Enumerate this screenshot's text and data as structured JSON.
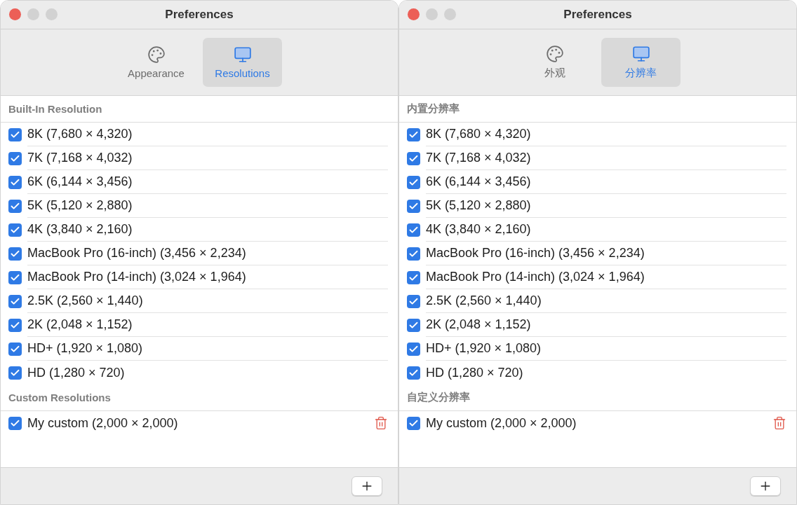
{
  "windows": [
    {
      "title": "Preferences",
      "tabs": [
        {
          "kind": "palette",
          "label": "Appearance",
          "selected": false
        },
        {
          "kind": "display",
          "label": "Resolutions",
          "selected": true
        }
      ],
      "sections": [
        {
          "title": "Built-In Resolution",
          "items": [
            {
              "label": "8K (7,680 × 4,320)",
              "checked": true,
              "removable": false
            },
            {
              "label": "7K (7,168 × 4,032)",
              "checked": true,
              "removable": false
            },
            {
              "label": "6K (6,144 × 3,456)",
              "checked": true,
              "removable": false
            },
            {
              "label": "5K (5,120 × 2,880)",
              "checked": true,
              "removable": false
            },
            {
              "label": "4K (3,840 × 2,160)",
              "checked": true,
              "removable": false
            },
            {
              "label": "MacBook Pro (16-inch) (3,456 × 2,234)",
              "checked": true,
              "removable": false
            },
            {
              "label": "MacBook Pro (14-inch) (3,024 × 1,964)",
              "checked": true,
              "removable": false
            },
            {
              "label": "2.5K (2,560 × 1,440)",
              "checked": true,
              "removable": false
            },
            {
              "label": "2K (2,048 × 1,152)",
              "checked": true,
              "removable": false
            },
            {
              "label": "HD+ (1,920 × 1,080)",
              "checked": true,
              "removable": false
            },
            {
              "label": "HD (1,280 × 720)",
              "checked": true,
              "removable": false
            }
          ]
        },
        {
          "title": "Custom Resolutions",
          "items": [
            {
              "label": "My custom (2,000 × 2,000)",
              "checked": true,
              "removable": true
            }
          ]
        }
      ]
    },
    {
      "title": "Preferences",
      "tabs": [
        {
          "kind": "palette",
          "label": "外观",
          "selected": false
        },
        {
          "kind": "display",
          "label": "分辨率",
          "selected": true
        }
      ],
      "sections": [
        {
          "title": "内置分辨率",
          "items": [
            {
              "label": "8K (7,680 × 4,320)",
              "checked": true,
              "removable": false
            },
            {
              "label": "7K (7,168 × 4,032)",
              "checked": true,
              "removable": false
            },
            {
              "label": "6K (6,144 × 3,456)",
              "checked": true,
              "removable": false
            },
            {
              "label": "5K (5,120 × 2,880)",
              "checked": true,
              "removable": false
            },
            {
              "label": "4K (3,840 × 2,160)",
              "checked": true,
              "removable": false
            },
            {
              "label": "MacBook Pro (16-inch) (3,456 × 2,234)",
              "checked": true,
              "removable": false
            },
            {
              "label": "MacBook Pro (14-inch) (3,024 × 1,964)",
              "checked": true,
              "removable": false
            },
            {
              "label": "2.5K (2,560 × 1,440)",
              "checked": true,
              "removable": false
            },
            {
              "label": "2K (2,048 × 1,152)",
              "checked": true,
              "removable": false
            },
            {
              "label": "HD+ (1,920 × 1,080)",
              "checked": true,
              "removable": false
            },
            {
              "label": "HD (1,280 × 720)",
              "checked": true,
              "removable": false
            }
          ]
        },
        {
          "title": "自定义分辨率",
          "items": [
            {
              "label": "My custom (2,000 × 2,000)",
              "checked": true,
              "removable": true
            }
          ]
        }
      ]
    }
  ]
}
